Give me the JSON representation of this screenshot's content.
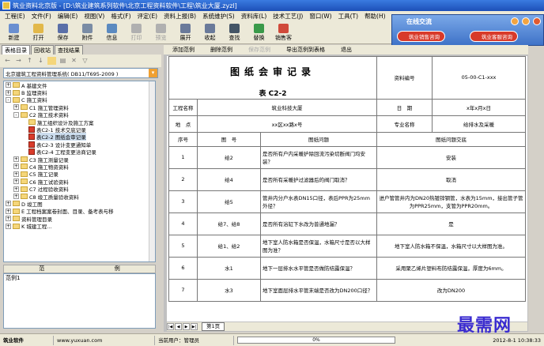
{
  "window": {
    "title": "筑业资料北京版 - [D:\\筑业建筑系列软件\\北京工程资料软件\\工程\\筑业大厦.zyzl]"
  },
  "menu": [
    "工程(E)",
    "文件(F)",
    "编辑(E)",
    "视图(V)",
    "格式(F)",
    "评定(E)",
    "资料上报(B)",
    "系统维护(S)",
    "资料库(L)",
    "技术工艺(J)",
    "窗口(W)",
    "工具(T)",
    "帮助(H)"
  ],
  "toolbar": [
    {
      "label": "新建",
      "icon": "new-icon",
      "color": "#6a8fd0",
      "enabled": true
    },
    {
      "label": "打开",
      "icon": "open-icon",
      "color": "#e2b84a",
      "enabled": true
    },
    {
      "label": "保存",
      "icon": "save-icon",
      "color": "#5a6fa8",
      "enabled": true
    },
    {
      "label": "附件",
      "icon": "attach-icon",
      "color": "#7a8ca5",
      "enabled": true
    },
    {
      "label": "信息",
      "icon": "info-icon",
      "color": "#5b8ac0",
      "enabled": true
    },
    {
      "label": "打印",
      "icon": "print-icon",
      "color": "#b0b0b0",
      "enabled": false
    },
    {
      "label": "预览",
      "icon": "preview-icon",
      "color": "#b0b0b0",
      "enabled": false
    },
    {
      "label": "展开",
      "icon": "expand-icon",
      "color": "#6a7a9a",
      "enabled": true
    },
    {
      "label": "收起",
      "icon": "collapse-icon",
      "color": "#6a7a9a",
      "enabled": true
    },
    {
      "label": "查找",
      "icon": "find-icon",
      "color": "#445566",
      "enabled": true
    },
    {
      "label": "替换",
      "icon": "replace-icon",
      "color": "#3a9a4a",
      "enabled": true
    },
    {
      "label": "销售客",
      "icon": "sales-icon",
      "color": "#d04a3a",
      "enabled": true
    }
  ],
  "left_panel": {
    "tabs": [
      "表格目录",
      "回收站",
      "查找结果"
    ],
    "selector": "北京建筑工程资料管理系统( DB11/T695-2009 )",
    "tree": [
      {
        "level": 0,
        "expander": "+",
        "type": "folder",
        "label": "A 基建文件"
      },
      {
        "level": 0,
        "expander": "+",
        "type": "folder",
        "label": "B 监理资料"
      },
      {
        "level": 0,
        "expander": "-",
        "type": "folder",
        "label": "C 施工资料"
      },
      {
        "level": 1,
        "expander": "+",
        "type": "folder",
        "label": "C1 施工管理资料"
      },
      {
        "level": 1,
        "expander": "-",
        "type": "folder",
        "label": "C2 施工技术资料"
      },
      {
        "level": 2,
        "expander": "",
        "type": "folder",
        "label": "施工组织设计及施工方案"
      },
      {
        "level": 2,
        "expander": "",
        "type": "doc",
        "label": "表C2-1 技术交底记录"
      },
      {
        "level": 2,
        "expander": "",
        "type": "doc",
        "label": "表C2-2 图纸会审记录",
        "selected": true
      },
      {
        "level": 2,
        "expander": "",
        "type": "doc",
        "label": "表C2-3 设计变更通知单"
      },
      {
        "level": 2,
        "expander": "",
        "type": "doc",
        "label": "表C2-4 工程变更洽商记录"
      },
      {
        "level": 1,
        "expander": "+",
        "type": "folder",
        "label": "C3 施工测量记录"
      },
      {
        "level": 1,
        "expander": "+",
        "type": "folder",
        "label": "C4 施工物资资料"
      },
      {
        "level": 1,
        "expander": "+",
        "type": "folder",
        "label": "C5 施工记录"
      },
      {
        "level": 1,
        "expander": "+",
        "type": "folder",
        "label": "C6 施工试验资料"
      },
      {
        "level": 1,
        "expander": "+",
        "type": "folder",
        "label": "C7 过程验收资料"
      },
      {
        "level": 1,
        "expander": "+",
        "type": "folder",
        "label": "C8 竣工质量验收资料"
      },
      {
        "level": 0,
        "expander": "+",
        "type": "folder",
        "label": "D 竣工图"
      },
      {
        "level": 0,
        "expander": "+",
        "type": "folder",
        "label": "E 工程档案案卷封面、目录、备考表与移"
      },
      {
        "level": 0,
        "expander": "+",
        "type": "folder",
        "label": "资料管理目录"
      },
      {
        "level": 0,
        "expander": "+",
        "type": "folder",
        "label": "K 城建工程..."
      }
    ],
    "list_header": [
      "范",
      "例"
    ],
    "list_items": [
      "范例1"
    ]
  },
  "main_toolbar": [
    {
      "label": "添加范例",
      "enabled": true
    },
    {
      "label": "删除范例",
      "enabled": true
    },
    {
      "label": "保存范例",
      "enabled": false
    },
    {
      "label": "导出范例到表格",
      "enabled": true
    },
    {
      "label": "退出",
      "enabled": true
    }
  ],
  "form": {
    "title": "图纸会审记录",
    "subtitle": "表 C2-2",
    "doc_no_label": "资料编号",
    "doc_no": "05-00-C1-xxx",
    "project_label": "工程名称",
    "project": "筑业科技大厦",
    "date_label": "日　期",
    "date": "x年x月x日",
    "location_label": "地　点",
    "location": "xx区xx路x号",
    "specialty_label": "专业名称",
    "specialty": "给排水及采暖",
    "col_no": "序号",
    "col_drawing": "图　号",
    "col_issue": "图纸问题",
    "col_answer": "图纸问题交底",
    "rows": [
      {
        "no": "1",
        "drawing": "给2",
        "issue": "是否所有户内采暖护除回流污染切断阀门均安装？",
        "answer": "安装"
      },
      {
        "no": "2",
        "drawing": "给4",
        "issue": "是否所有采暖护过滤器后的阀门取消？",
        "answer": "取消"
      },
      {
        "no": "3",
        "drawing": "给5",
        "issue": "管井内分户水表DN15口径，表后PPR为25mm外径？",
        "answer": "进户管管井内为DN20热镀锌钢管，水表为15mm，接出管子管为PPR25mm，支管为PPR20mm。"
      },
      {
        "no": "4",
        "drawing": "给7、给8",
        "issue": "是否所有浴缸下水改为普通地漏？",
        "answer": "是"
      },
      {
        "no": "5",
        "drawing": "给1、给2",
        "issue": "地下室人防水箱是否保温，水箱尺寸是否以大样图为准？",
        "answer": "地下室人防水箱不保温，水箱尺寸以大样图为准。"
      },
      {
        "no": "6",
        "drawing": "水1",
        "issue": "地下一层排水水平管是否做防结露保温？",
        "answer": "采用聚乙烯片塑料布防结露保温，厚度为6mm。"
      },
      {
        "no": "7",
        "drawing": "水3",
        "issue": "地下室面层排水平管末端是否改为DN200口径？",
        "answer": "改为DN200"
      }
    ]
  },
  "sheet_tab": "第1页",
  "chat": {
    "title": "在线交流",
    "btn1": "筑业销售咨询",
    "btn2": "筑业客服咨询"
  },
  "status": {
    "company": "筑业软件",
    "url": "www.yuxuan.com",
    "user_label": "当前用户：管理员",
    "progress": "0%",
    "datetime": "2012-8-1  10:38:33"
  },
  "watermark": "最需网",
  "colors": {
    "accent": "#1c4fb8",
    "selected": "#cde",
    "doc_icon": "#d93b2b"
  }
}
